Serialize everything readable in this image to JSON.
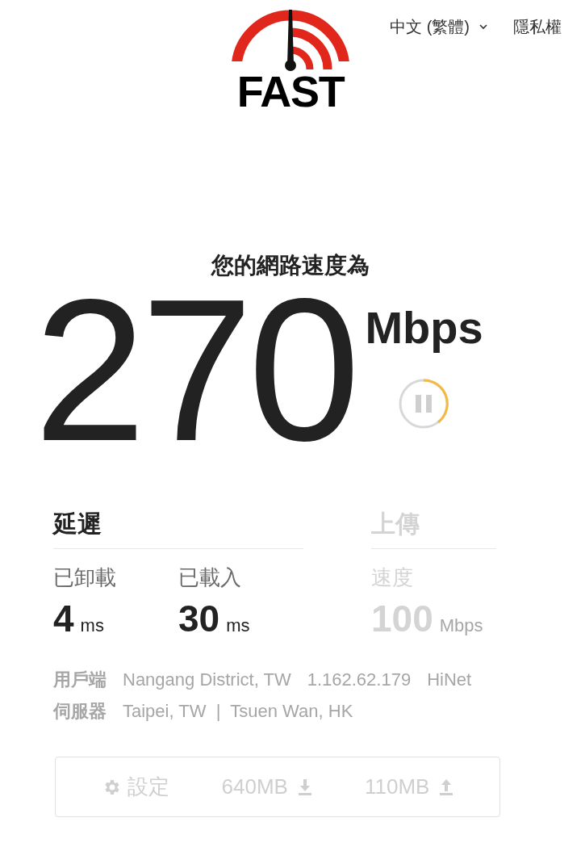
{
  "logo": {
    "text": "FAST"
  },
  "header": {
    "language": "中文 (繁體)",
    "privacy": "隱私權"
  },
  "speed": {
    "heading": "您的網路速度為",
    "value": "270",
    "unit": "Mbps"
  },
  "sections": [
    {
      "title": "延遲",
      "dimmed": false,
      "metrics": [
        {
          "label": "已卸載",
          "value": "4",
          "unit": "ms"
        },
        {
          "label": "已載入",
          "value": "30",
          "unit": "ms"
        }
      ]
    },
    {
      "title": "上傳",
      "dimmed": true,
      "metrics": [
        {
          "label": "速度",
          "value": "100",
          "unit": "Mbps"
        }
      ]
    }
  ],
  "info": [
    {
      "label": "用戶端",
      "values": [
        "Nangang District, TW",
        "1.162.62.179",
        "HiNet"
      ]
    },
    {
      "label": "伺服器",
      "values": [
        "Taipei, TW  |  Tsuen Wan, HK"
      ]
    }
  ],
  "footer": {
    "settings": "設定",
    "download": "640MB",
    "upload": "110MB"
  }
}
